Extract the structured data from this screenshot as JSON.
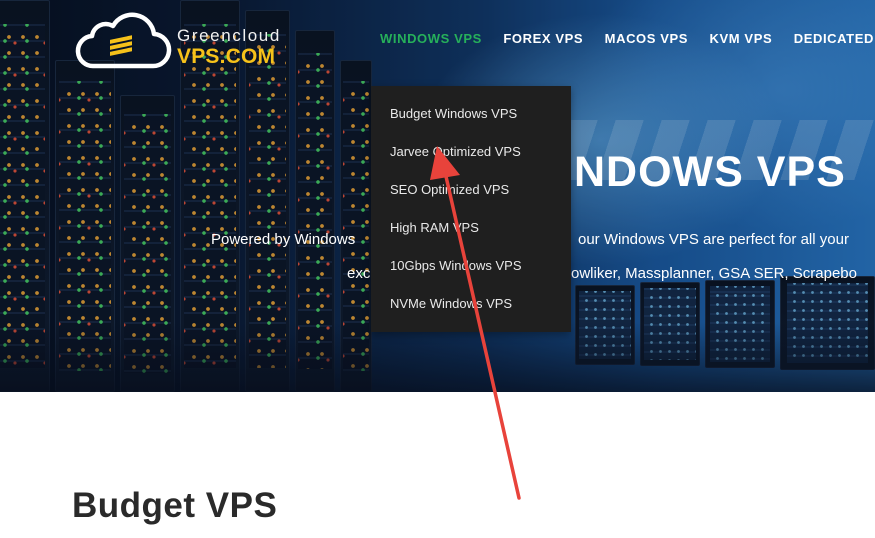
{
  "brand": {
    "line1": "Greencloud",
    "line2": "VPS.COM",
    "accent_color": "#f6c21a"
  },
  "nav": {
    "active_color": "#26b05a",
    "items": [
      {
        "label": "WINDOWS VPS",
        "active": true
      },
      {
        "label": "FOREX VPS",
        "active": false
      },
      {
        "label": "MACOS VPS",
        "active": false
      },
      {
        "label": "KVM VPS",
        "active": false
      },
      {
        "label": "DEDICATED",
        "active": false
      }
    ]
  },
  "dropdown": {
    "items": [
      "Budget Windows VPS",
      "Jarvee Optimized VPS",
      "SEO Optimized VPS",
      "High RAM VPS",
      "10Gbps Windows VPS",
      "NVMe Windows VPS"
    ]
  },
  "hero": {
    "title_visible": "NDOWS VPS",
    "subtitle_left": "Powered by Windows",
    "subtitle_right": "our Windows VPS are perfect for all your",
    "line2_left": "exc",
    "line2_right": "owliker, Massplanner, GSA SER, Scrapebo"
  },
  "content": {
    "section_title": "Budget VPS"
  },
  "annotation": {
    "arrow_color": "#e8433b",
    "icon": "red-arrow"
  }
}
